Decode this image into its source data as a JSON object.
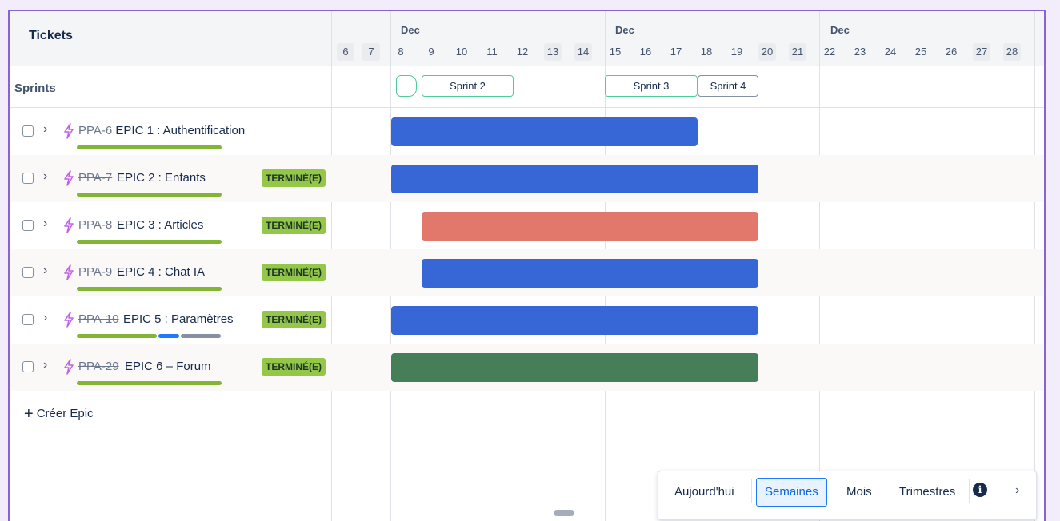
{
  "header": {
    "tickets_label": "Tickets",
    "sprints_label": "Sprints"
  },
  "timeline": {
    "months": [
      "Dec",
      "Dec",
      "Dec"
    ],
    "days": [
      "6",
      "7",
      "8",
      "9",
      "10",
      "11",
      "12",
      "13",
      "14",
      "15",
      "16",
      "17",
      "18",
      "19",
      "20",
      "21",
      "22",
      "23",
      "24",
      "25",
      "26",
      "27",
      "28"
    ]
  },
  "sprints": [
    {
      "label": ""
    },
    {
      "label": "Sprint 2"
    },
    {
      "label": "Sprint 3"
    },
    {
      "label": "Sprint 4"
    }
  ],
  "epics": [
    {
      "key": "PPA-6",
      "title": "EPIC 1 : Authentification",
      "status": "",
      "done": false,
      "icon": "lightning-icon",
      "bar_color": "#3767d7"
    },
    {
      "key": "PPA-7",
      "title": "EPIC 2 : Enfants",
      "status": "TERMINÉ(E)",
      "done": true,
      "icon": "lightning-icon",
      "bar_color": "#3767d7"
    },
    {
      "key": "PPA-8",
      "title": "EPIC 3 : Articles",
      "status": "TERMINÉ(E)",
      "done": true,
      "icon": "lightning-icon",
      "bar_color": "#e2786b"
    },
    {
      "key": "PPA-9",
      "title": "EPIC 4 : Chat IA",
      "status": "TERMINÉ(E)",
      "done": true,
      "icon": "lightning-icon",
      "bar_color": "#3767d7"
    },
    {
      "key": "PPA-10",
      "title": "EPIC 5 : Paramètres",
      "status": "TERMINÉ(E)",
      "done": true,
      "icon": "lightning-icon",
      "bar_color": "#3767d7"
    },
    {
      "key": "PPA-29",
      "title": "EPIC 6 – Forum",
      "status": "TERMINÉ(E)",
      "done": true,
      "icon": "lightning-icon",
      "bar_color": "#467f57"
    }
  ],
  "create_epic_label": "Créer Epic",
  "toolbar": {
    "today": "Aujourd'hui",
    "weeks": "Semaines",
    "months": "Mois",
    "quarters": "Trimestres",
    "active": "Semaines"
  },
  "colors": {
    "accent": "#8a63d2",
    "status_done": "#94c748",
    "progress_done": "#82b536",
    "progress_in_progress": "#1d7afc",
    "progress_todo": "#8590a2",
    "sprint_active_border": "#4bce97"
  }
}
